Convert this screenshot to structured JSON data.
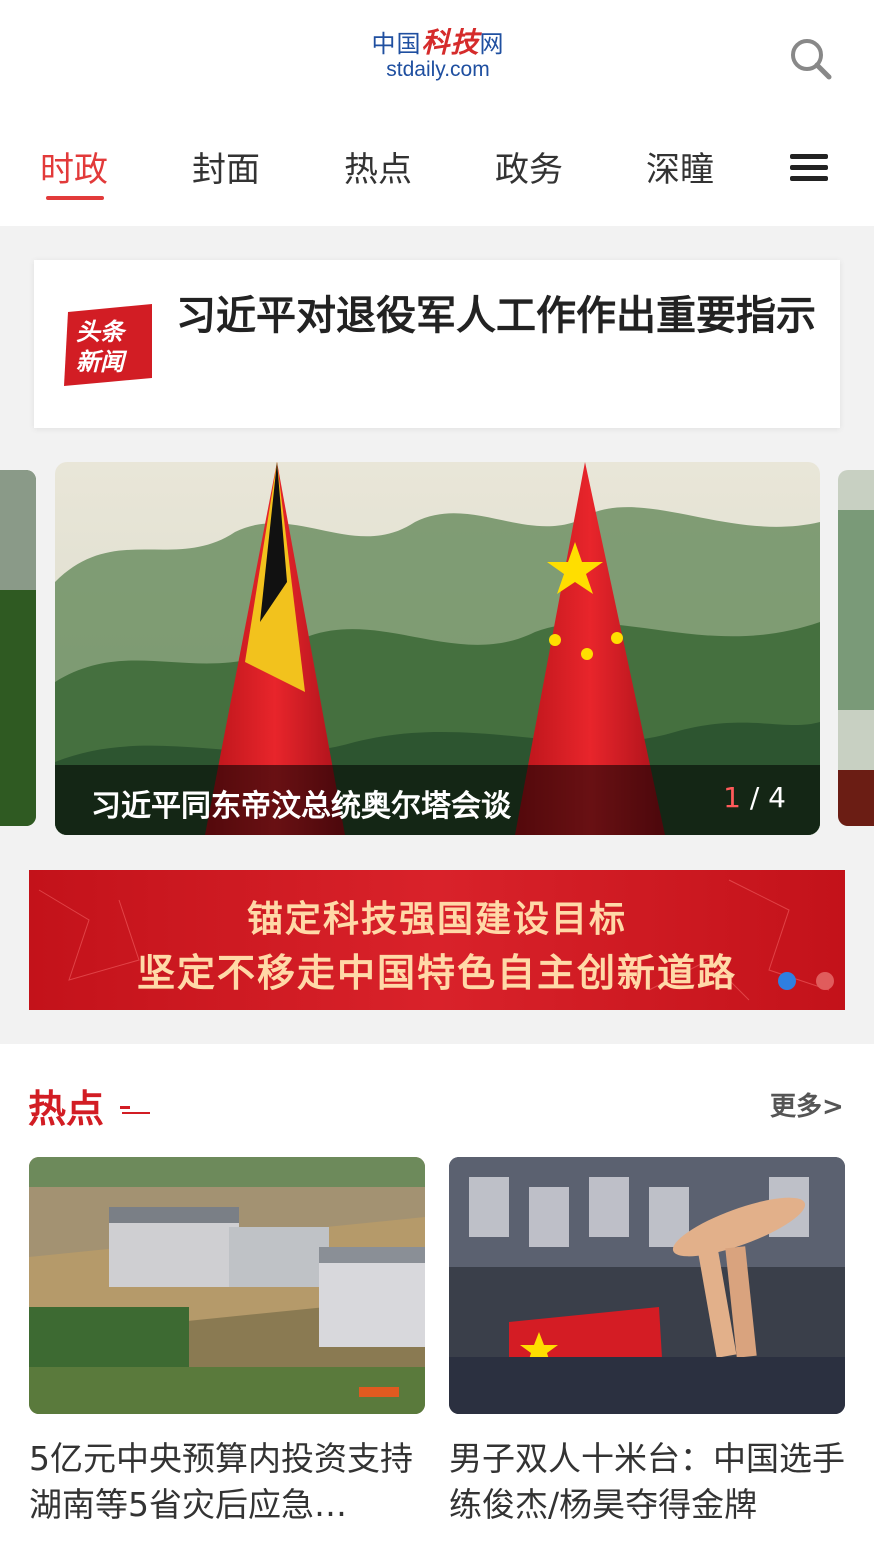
{
  "header": {
    "logo_cn_a": "中国",
    "logo_cn_b": "科技",
    "logo_cn_c": "网",
    "logo_en": "stdaily.com",
    "search_icon": "search-icon"
  },
  "tabs": [
    {
      "label": "时政",
      "active": true
    },
    {
      "label": "封面",
      "active": false
    },
    {
      "label": "热点",
      "active": false
    },
    {
      "label": "政务",
      "active": false
    },
    {
      "label": "深瞳",
      "active": false
    }
  ],
  "headline": {
    "badge_line1": "头条",
    "badge_line2": "新闻",
    "text": "习近平对退役军人工作作出重要指示"
  },
  "carousel": {
    "caption": "习近平同东帝汶总统奥尔塔会谈",
    "current": "1",
    "separator": " / ",
    "total": "4"
  },
  "banner": {
    "line1": "锚定科技强国建设目标",
    "line2": "坚定不移走中国特色自主创新道路"
  },
  "hot": {
    "title": "热点",
    "more": "更多>",
    "items": [
      {
        "title": "5亿元中央预算内投资支持湖南等5省灾后应急…"
      },
      {
        "title": "男子双人十米台：中国选手练俊杰/杨昊夺得金牌"
      }
    ]
  },
  "colors": {
    "accent": "#e23a3a",
    "brand_blue": "#1f4fa0",
    "banner_red": "#c3121a"
  }
}
